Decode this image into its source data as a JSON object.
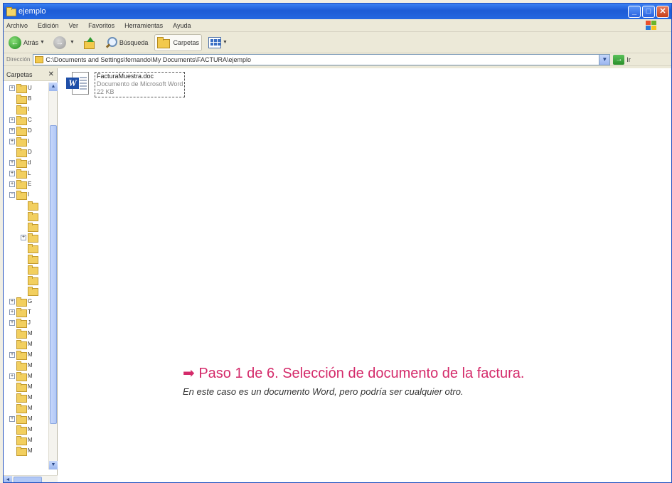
{
  "window": {
    "title": "ejemplo"
  },
  "menubar": {
    "items": [
      "Archivo",
      "Edición",
      "Ver",
      "Favoritos",
      "Herramientas",
      "Ayuda"
    ]
  },
  "toolbar": {
    "back_label": "Atrás",
    "search_label": "Búsqueda",
    "folders_label": "Carpetas"
  },
  "address": {
    "label": "Dirección",
    "path": "C:\\Documents and Settings\\fernando\\My Documents\\FACTURA\\ejemplo",
    "go_label": "Ir"
  },
  "folders_pane": {
    "title": "Carpetas",
    "tree": [
      {
        "letter": "U",
        "expander": "+",
        "indent": 0
      },
      {
        "letter": "B",
        "expander": "",
        "indent": 0
      },
      {
        "letter": "I",
        "expander": "",
        "indent": 0
      },
      {
        "letter": "C",
        "expander": "+",
        "indent": 0
      },
      {
        "letter": "D",
        "expander": "+",
        "indent": 0
      },
      {
        "letter": "I",
        "expander": "+",
        "indent": 0
      },
      {
        "letter": "D",
        "expander": "",
        "indent": 0
      },
      {
        "letter": "d",
        "expander": "+",
        "indent": 0
      },
      {
        "letter": "L",
        "expander": "+",
        "indent": 0
      },
      {
        "letter": "E",
        "expander": "+",
        "indent": 0
      },
      {
        "letter": "I",
        "expander": "-",
        "indent": 0
      },
      {
        "letter": "",
        "expander": "",
        "indent": 1
      },
      {
        "letter": "",
        "expander": "",
        "indent": 1
      },
      {
        "letter": "",
        "expander": "",
        "indent": 1
      },
      {
        "letter": "",
        "expander": "+",
        "indent": 1
      },
      {
        "letter": "",
        "expander": "",
        "indent": 1
      },
      {
        "letter": "",
        "expander": "",
        "indent": 1
      },
      {
        "letter": "",
        "expander": "",
        "indent": 1
      },
      {
        "letter": "",
        "expander": "",
        "indent": 1
      },
      {
        "letter": "",
        "expander": "",
        "indent": 1
      },
      {
        "letter": "G",
        "expander": "+",
        "indent": 0
      },
      {
        "letter": "T",
        "expander": "+",
        "indent": 0
      },
      {
        "letter": "J",
        "expander": "+",
        "indent": 0
      },
      {
        "letter": "M",
        "expander": "",
        "indent": 0
      },
      {
        "letter": "M",
        "expander": "",
        "indent": 0
      },
      {
        "letter": "M",
        "expander": "+",
        "indent": 0
      },
      {
        "letter": "M",
        "expander": "",
        "indent": 0
      },
      {
        "letter": "M",
        "expander": "+",
        "indent": 0
      },
      {
        "letter": "M",
        "expander": "",
        "indent": 0
      },
      {
        "letter": "M",
        "expander": "",
        "indent": 0
      },
      {
        "letter": "M",
        "expander": "",
        "indent": 0
      },
      {
        "letter": "M",
        "expander": "+",
        "indent": 0
      },
      {
        "letter": "M",
        "expander": "",
        "indent": 0
      },
      {
        "letter": "M",
        "expander": "",
        "indent": 0
      },
      {
        "letter": "M",
        "expander": "",
        "indent": 0
      }
    ]
  },
  "file": {
    "name": "FacturaMuestra.doc",
    "type": "Documento de Microsoft Word",
    "size": "22 KB"
  },
  "caption": {
    "arrow": "➡",
    "headline": "Paso 1 de 6. Selección de documento de la factura.",
    "subtitle": "En este caso es un documento Word, pero podría ser cualquier otro."
  },
  "colors": {
    "accent": "#d42a6a",
    "titlebar": "#2467e0"
  }
}
